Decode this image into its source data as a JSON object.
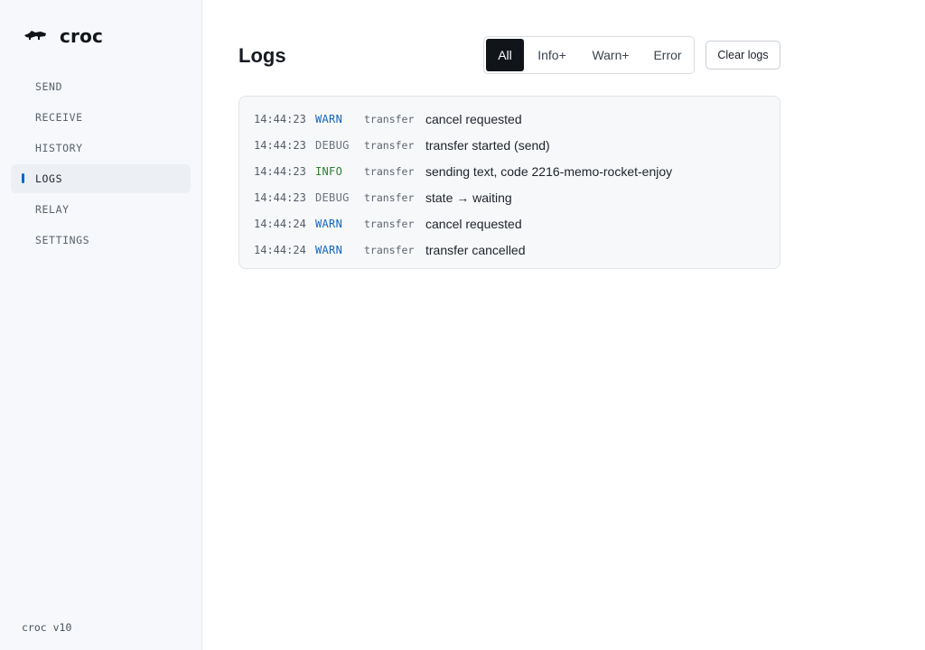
{
  "app": {
    "name": "croc",
    "version": "croc v10"
  },
  "sidebar": {
    "items": [
      {
        "label": "SEND",
        "active": false
      },
      {
        "label": "RECEIVE",
        "active": false
      },
      {
        "label": "HISTORY",
        "active": false
      },
      {
        "label": "LOGS",
        "active": true
      },
      {
        "label": "RELAY",
        "active": false
      },
      {
        "label": "SETTINGS",
        "active": false
      }
    ]
  },
  "main": {
    "title": "Logs",
    "filters": [
      {
        "label": "All",
        "active": true
      },
      {
        "label": "Info+",
        "active": false
      },
      {
        "label": "Warn+",
        "active": false
      },
      {
        "label": "Error",
        "active": false
      }
    ],
    "clear_label": "Clear logs",
    "logs": [
      {
        "time": "14:44:23",
        "level": "WARN",
        "source": "transfer",
        "message": "cancel requested"
      },
      {
        "time": "14:44:23",
        "level": "DEBUG",
        "source": "transfer",
        "message": "transfer started (send)"
      },
      {
        "time": "14:44:23",
        "level": "INFO",
        "source": "transfer",
        "message": "sending text, code 2216-memo-rocket-enjoy"
      },
      {
        "time": "14:44:23",
        "level": "DEBUG",
        "source": "transfer",
        "message": "state → waiting"
      },
      {
        "time": "14:44:24",
        "level": "WARN",
        "source": "transfer",
        "message": "cancel requested"
      },
      {
        "time": "14:44:24",
        "level": "WARN",
        "source": "transfer",
        "message": "transfer cancelled"
      }
    ]
  },
  "colors": {
    "accent": "#0b68c8",
    "warn": "#1565c0",
    "info": "#2e7d32",
    "debug": "#6b737d",
    "active_filter_bg": "#11151a"
  },
  "icons": {
    "logo": "croc-icon"
  }
}
